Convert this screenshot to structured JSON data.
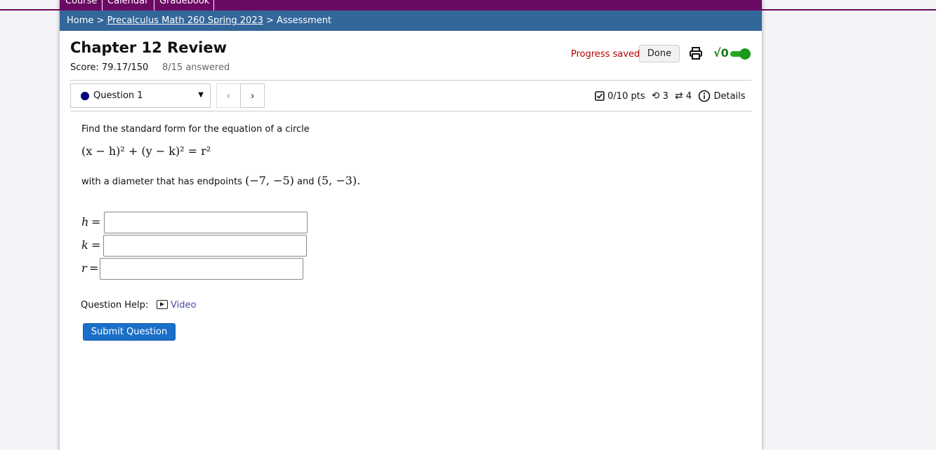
{
  "topnav": {
    "items": [
      "Course",
      "Calendar",
      "Gradebook"
    ]
  },
  "breadcrumb": {
    "home": "Home",
    "sep1": " > ",
    "course": "Precalculus Math 260 Spring 2023",
    "sep2": " > ",
    "current": "Assessment"
  },
  "assessment": {
    "title": "Chapter 12 Review",
    "score": "Score: 79.17/150",
    "answered": "8/15 answered",
    "progress": "Progress saved",
    "done": "Done",
    "print_icon": "printer-icon",
    "sqrt_icon": "√0",
    "toggle_state": "on"
  },
  "question_nav": {
    "selected": "Question 1",
    "prev": "‹",
    "next": "›"
  },
  "stats": {
    "points": "0/10 pts",
    "attempts": "3",
    "regens": "4",
    "details": "Details"
  },
  "question": {
    "prompt1": "Find the standard form for the equation of a circle",
    "formula": "(x − h)² + (y − k)² = r²",
    "prompt2_pre": "with a diameter that has endpoints ",
    "point1": "(−7, −5)",
    "and": " and ",
    "point2": "(5, −3)",
    "period": ".",
    "fields": [
      {
        "var": "h",
        "eq": "=",
        "value": ""
      },
      {
        "var": "k",
        "eq": "=",
        "value": ""
      },
      {
        "var": "r",
        "eq": "=",
        "value": ""
      }
    ],
    "help_label": "Question Help:",
    "video": "Video",
    "submit": "Submit Question"
  },
  "colors": {
    "nav": "#6b0a63",
    "breadcrumb": "#336699",
    "submit": "#1a6fc9",
    "progress": "#b00000"
  }
}
